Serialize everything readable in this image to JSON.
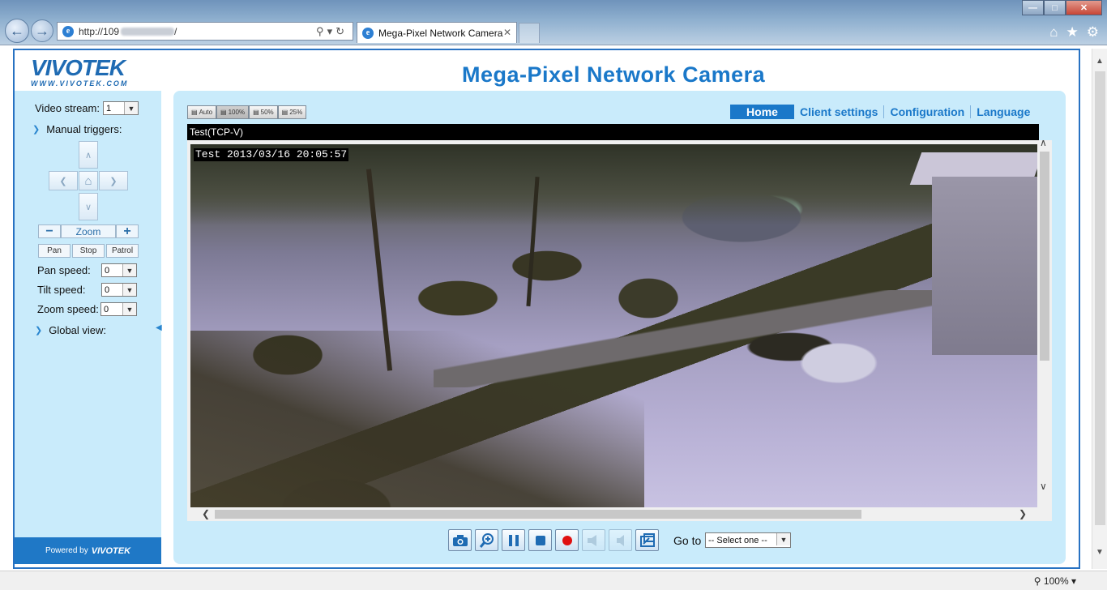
{
  "browser": {
    "url_prefix": "http://109",
    "url_suffix": "/",
    "tab_title": "Mega-Pixel Network Camera",
    "zoom": "100%"
  },
  "header": {
    "logo_text": "VIVOTEK",
    "logo_url": "WWW.VIVOTEK.COM",
    "title": "Mega-Pixel Network Camera"
  },
  "sidebar": {
    "video_stream_label": "Video stream:",
    "video_stream_value": "1",
    "manual_triggers_label": "Manual triggers:",
    "zoom_label": "Zoom",
    "pan_label": "Pan",
    "stop_label": "Stop",
    "patrol_label": "Patrol",
    "pan_speed_label": "Pan speed:",
    "pan_speed_value": "0",
    "tilt_speed_label": "Tilt speed:",
    "tilt_speed_value": "0",
    "zoom_speed_label": "Zoom speed:",
    "zoom_speed_value": "0",
    "global_view_label": "Global view:",
    "powered_by": "Powered by",
    "powered_brand": "VIVOTEK"
  },
  "view_sizes": [
    {
      "label": "Auto",
      "active": false
    },
    {
      "label": "100%",
      "active": true
    },
    {
      "label": "50%",
      "active": false
    },
    {
      "label": "25%",
      "active": false
    }
  ],
  "nav": {
    "home": "Home",
    "client_settings": "Client settings",
    "configuration": "Configuration",
    "language": "Language"
  },
  "video": {
    "stream_title": "Test(TCP-V)",
    "timestamp": "Test 2013/03/16 20:05:57"
  },
  "controls": {
    "goto_label": "Go to",
    "goto_value": "-- Select one --"
  },
  "colors": {
    "accent": "#1a78c9",
    "panel_bg": "#c9ebfb",
    "record": "#e01010"
  }
}
